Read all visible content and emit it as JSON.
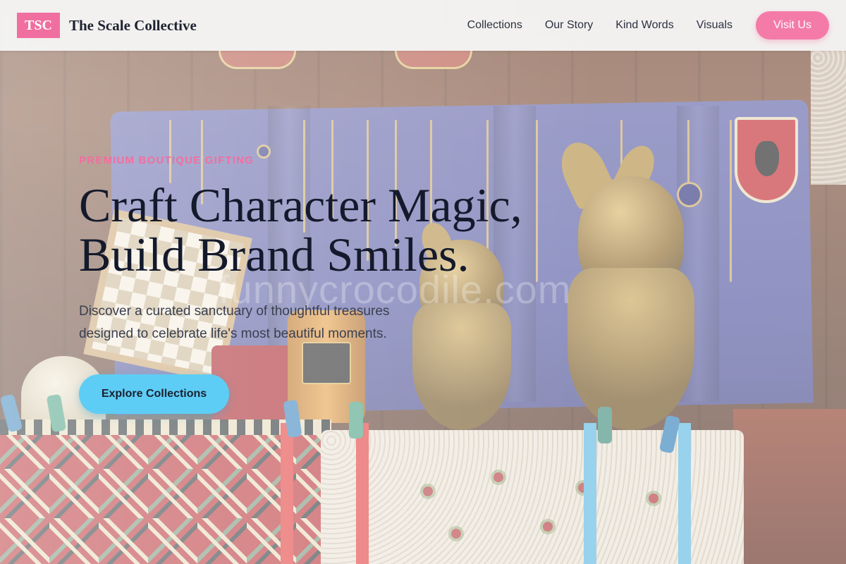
{
  "brand": {
    "logo_text": "TSC",
    "name": "The Scale Collective"
  },
  "nav": {
    "links": [
      "Collections",
      "Our Story",
      "Kind Words",
      "Visuals"
    ],
    "cta_label": "Visit Us"
  },
  "hero": {
    "eyebrow": "PREMIUM BOUTIQUE GIFTING",
    "headline_line1": "Craft Character Magic,",
    "headline_line2": "Build Brand Smiles.",
    "subtext_line1": "Discover a curated sanctuary of thoughtful treasures",
    "subtext_line2": "designed to celebrate life's most beautiful moments.",
    "cta_label": "Explore Collections",
    "watermark": "funnycrocodile.com"
  },
  "colors": {
    "accent_pink": "#f06fa0",
    "cta_blue": "#5ecdf5",
    "heading": "#141a2c"
  },
  "icons": {
    "logo": "tsc-logo-badge"
  }
}
